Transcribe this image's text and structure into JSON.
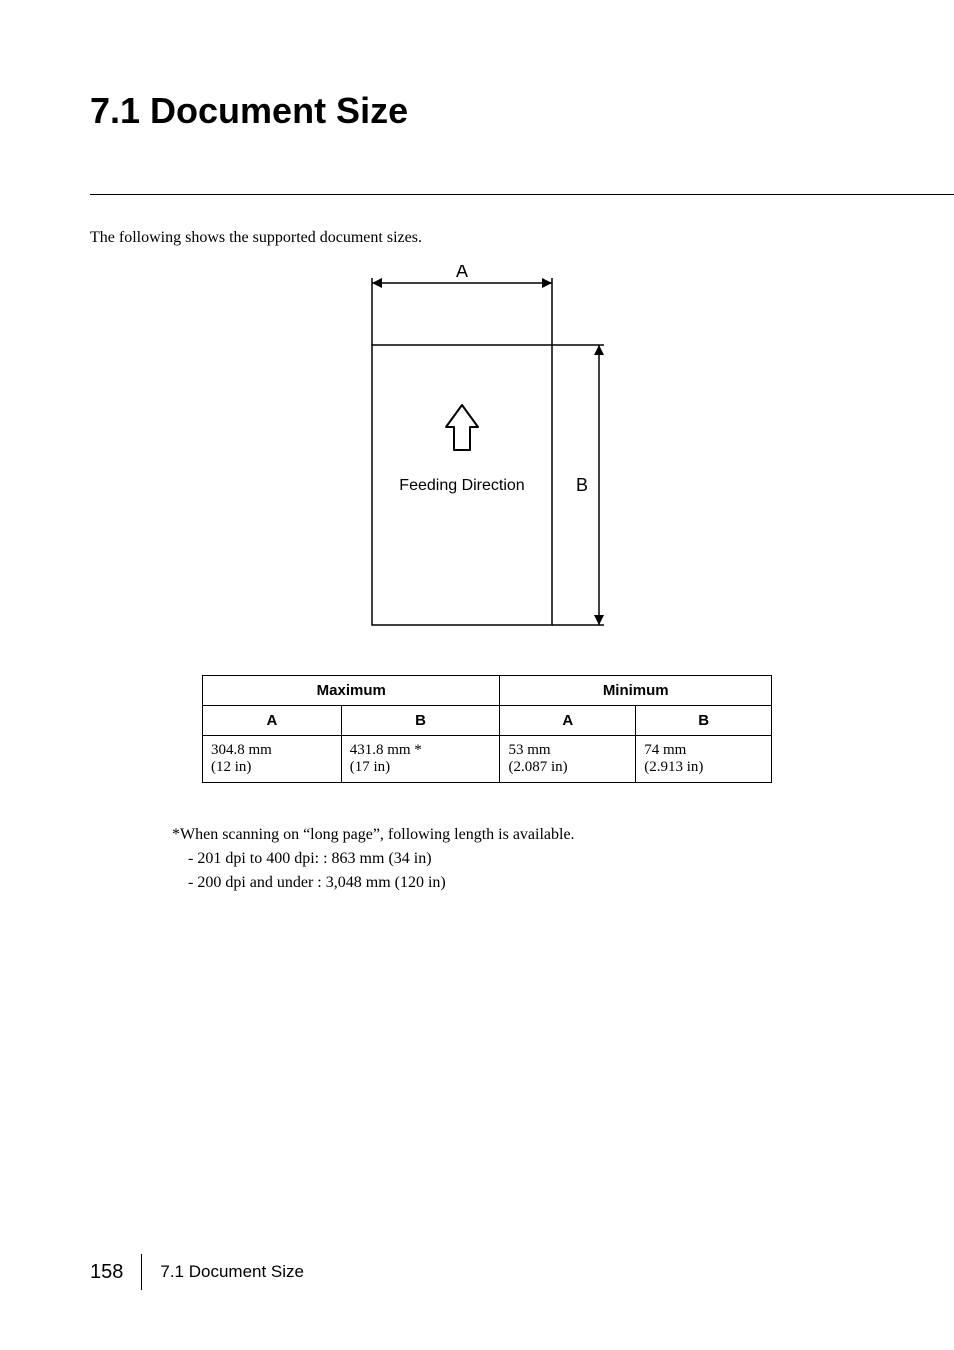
{
  "heading": "7.1  Document Size",
  "intro": "The following shows the supported document sizes.",
  "diagram": {
    "label_a": "A",
    "label_b": "B",
    "feeding_direction": "Feeding Direction"
  },
  "table": {
    "head": {
      "maximum": "Maximum",
      "minimum": "Minimum",
      "a": "A",
      "b": "B"
    },
    "row": {
      "max_a_mm": "304.8 mm",
      "max_a_in": "(12 in)",
      "max_b_mm": "431.8 mm *",
      "max_b_in": "(17 in)",
      "min_a_mm": "53 mm",
      "min_a_in": "(2.087 in)",
      "min_b_mm": "74 mm",
      "min_b_in": "(2.913 in)"
    }
  },
  "notes": {
    "lead": "*When scanning on “long page”, following length is available.",
    "line1": "- 201 dpi to 400 dpi: : 863 mm (34 in)",
    "line2": "- 200 dpi and under  : 3,048 mm (120 in)"
  },
  "footer": {
    "page": "158",
    "title": "7.1 Document Size"
  }
}
